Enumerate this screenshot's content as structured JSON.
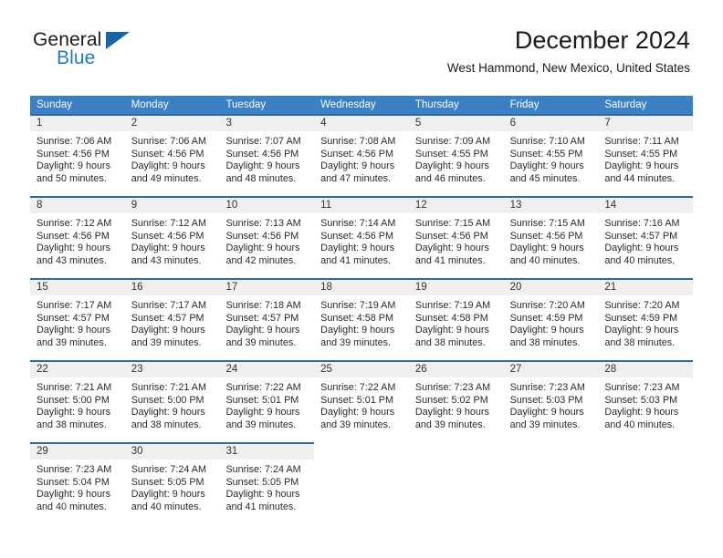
{
  "brand": {
    "name_part1": "General",
    "name_part2": "Blue"
  },
  "header": {
    "title": "December 2024",
    "location": "West Hammond, New Mexico, United States"
  },
  "colors": {
    "header_blue": "#3b7fc4",
    "row_rule_blue": "#2b6ca8",
    "daynum_band": "#efefef",
    "logo_blue": "#1f7ac4"
  },
  "weekdays": [
    "Sunday",
    "Monday",
    "Tuesday",
    "Wednesday",
    "Thursday",
    "Friday",
    "Saturday"
  ],
  "weeks": [
    [
      {
        "day": "1",
        "lines": [
          "Sunrise: 7:06 AM",
          "Sunset: 4:56 PM",
          "Daylight: 9 hours",
          "and 50 minutes."
        ]
      },
      {
        "day": "2",
        "lines": [
          "Sunrise: 7:06 AM",
          "Sunset: 4:56 PM",
          "Daylight: 9 hours",
          "and 49 minutes."
        ]
      },
      {
        "day": "3",
        "lines": [
          "Sunrise: 7:07 AM",
          "Sunset: 4:56 PM",
          "Daylight: 9 hours",
          "and 48 minutes."
        ]
      },
      {
        "day": "4",
        "lines": [
          "Sunrise: 7:08 AM",
          "Sunset: 4:56 PM",
          "Daylight: 9 hours",
          "and 47 minutes."
        ]
      },
      {
        "day": "5",
        "lines": [
          "Sunrise: 7:09 AM",
          "Sunset: 4:55 PM",
          "Daylight: 9 hours",
          "and 46 minutes."
        ]
      },
      {
        "day": "6",
        "lines": [
          "Sunrise: 7:10 AM",
          "Sunset: 4:55 PM",
          "Daylight: 9 hours",
          "and 45 minutes."
        ]
      },
      {
        "day": "7",
        "lines": [
          "Sunrise: 7:11 AM",
          "Sunset: 4:55 PM",
          "Daylight: 9 hours",
          "and 44 minutes."
        ]
      }
    ],
    [
      {
        "day": "8",
        "lines": [
          "Sunrise: 7:12 AM",
          "Sunset: 4:56 PM",
          "Daylight: 9 hours",
          "and 43 minutes."
        ]
      },
      {
        "day": "9",
        "lines": [
          "Sunrise: 7:12 AM",
          "Sunset: 4:56 PM",
          "Daylight: 9 hours",
          "and 43 minutes."
        ]
      },
      {
        "day": "10",
        "lines": [
          "Sunrise: 7:13 AM",
          "Sunset: 4:56 PM",
          "Daylight: 9 hours",
          "and 42 minutes."
        ]
      },
      {
        "day": "11",
        "lines": [
          "Sunrise: 7:14 AM",
          "Sunset: 4:56 PM",
          "Daylight: 9 hours",
          "and 41 minutes."
        ]
      },
      {
        "day": "12",
        "lines": [
          "Sunrise: 7:15 AM",
          "Sunset: 4:56 PM",
          "Daylight: 9 hours",
          "and 41 minutes."
        ]
      },
      {
        "day": "13",
        "lines": [
          "Sunrise: 7:15 AM",
          "Sunset: 4:56 PM",
          "Daylight: 9 hours",
          "and 40 minutes."
        ]
      },
      {
        "day": "14",
        "lines": [
          "Sunrise: 7:16 AM",
          "Sunset: 4:57 PM",
          "Daylight: 9 hours",
          "and 40 minutes."
        ]
      }
    ],
    [
      {
        "day": "15",
        "lines": [
          "Sunrise: 7:17 AM",
          "Sunset: 4:57 PM",
          "Daylight: 9 hours",
          "and 39 minutes."
        ]
      },
      {
        "day": "16",
        "lines": [
          "Sunrise: 7:17 AM",
          "Sunset: 4:57 PM",
          "Daylight: 9 hours",
          "and 39 minutes."
        ]
      },
      {
        "day": "17",
        "lines": [
          "Sunrise: 7:18 AM",
          "Sunset: 4:57 PM",
          "Daylight: 9 hours",
          "and 39 minutes."
        ]
      },
      {
        "day": "18",
        "lines": [
          "Sunrise: 7:19 AM",
          "Sunset: 4:58 PM",
          "Daylight: 9 hours",
          "and 39 minutes."
        ]
      },
      {
        "day": "19",
        "lines": [
          "Sunrise: 7:19 AM",
          "Sunset: 4:58 PM",
          "Daylight: 9 hours",
          "and 38 minutes."
        ]
      },
      {
        "day": "20",
        "lines": [
          "Sunrise: 7:20 AM",
          "Sunset: 4:59 PM",
          "Daylight: 9 hours",
          "and 38 minutes."
        ]
      },
      {
        "day": "21",
        "lines": [
          "Sunrise: 7:20 AM",
          "Sunset: 4:59 PM",
          "Daylight: 9 hours",
          "and 38 minutes."
        ]
      }
    ],
    [
      {
        "day": "22",
        "lines": [
          "Sunrise: 7:21 AM",
          "Sunset: 5:00 PM",
          "Daylight: 9 hours",
          "and 38 minutes."
        ]
      },
      {
        "day": "23",
        "lines": [
          "Sunrise: 7:21 AM",
          "Sunset: 5:00 PM",
          "Daylight: 9 hours",
          "and 38 minutes."
        ]
      },
      {
        "day": "24",
        "lines": [
          "Sunrise: 7:22 AM",
          "Sunset: 5:01 PM",
          "Daylight: 9 hours",
          "and 39 minutes."
        ]
      },
      {
        "day": "25",
        "lines": [
          "Sunrise: 7:22 AM",
          "Sunset: 5:01 PM",
          "Daylight: 9 hours",
          "and 39 minutes."
        ]
      },
      {
        "day": "26",
        "lines": [
          "Sunrise: 7:23 AM",
          "Sunset: 5:02 PM",
          "Daylight: 9 hours",
          "and 39 minutes."
        ]
      },
      {
        "day": "27",
        "lines": [
          "Sunrise: 7:23 AM",
          "Sunset: 5:03 PM",
          "Daylight: 9 hours",
          "and 39 minutes."
        ]
      },
      {
        "day": "28",
        "lines": [
          "Sunrise: 7:23 AM",
          "Sunset: 5:03 PM",
          "Daylight: 9 hours",
          "and 40 minutes."
        ]
      }
    ],
    [
      {
        "day": "29",
        "lines": [
          "Sunrise: 7:23 AM",
          "Sunset: 5:04 PM",
          "Daylight: 9 hours",
          "and 40 minutes."
        ]
      },
      {
        "day": "30",
        "lines": [
          "Sunrise: 7:24 AM",
          "Sunset: 5:05 PM",
          "Daylight: 9 hours",
          "and 40 minutes."
        ]
      },
      {
        "day": "31",
        "lines": [
          "Sunrise: 7:24 AM",
          "Sunset: 5:05 PM",
          "Daylight: 9 hours",
          "and 41 minutes."
        ]
      },
      {
        "day": "",
        "lines": []
      },
      {
        "day": "",
        "lines": []
      },
      {
        "day": "",
        "lines": []
      },
      {
        "day": "",
        "lines": []
      }
    ]
  ]
}
